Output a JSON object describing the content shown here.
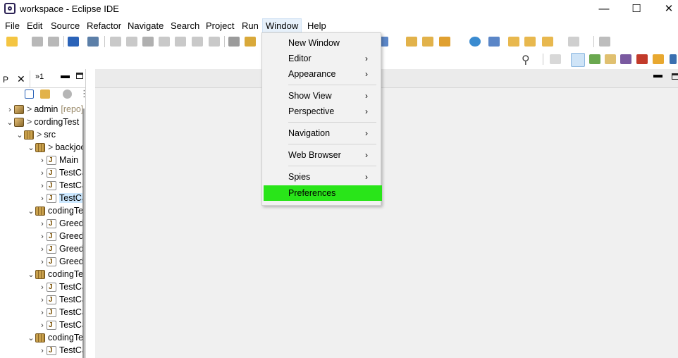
{
  "window": {
    "title": "workspace - Eclipse IDE",
    "minimize_glyph": "—",
    "maximize_glyph": "☐",
    "close_glyph": "✕"
  },
  "menubar": [
    "File",
    "Edit",
    "Source",
    "Refactor",
    "Navigate",
    "Search",
    "Project",
    "Run",
    "Window",
    "Help"
  ],
  "active_menu": "Window",
  "window_menu": {
    "items": [
      {
        "label": "New Window",
        "submenu": false
      },
      {
        "label": "Editor",
        "submenu": true
      },
      {
        "label": "Appearance",
        "submenu": true
      },
      {
        "label": "Show View",
        "submenu": true
      },
      {
        "label": "Perspective",
        "submenu": true
      },
      {
        "label": "Navigation",
        "submenu": true
      },
      {
        "label": "Web Browser",
        "submenu": true
      },
      {
        "label": "Spies",
        "submenu": true
      },
      {
        "label": "Preferences",
        "submenu": false,
        "highlighted": true
      }
    ],
    "arrow_glyph": "›",
    "highlight_color": "#29e519"
  },
  "left_panel": {
    "tab_label": "P",
    "close_glyph": "✕",
    "more_tabs": "»1",
    "minimize_glyph": "▬",
    "tree": [
      {
        "label": "admin",
        "decor": "[repo]",
        "prefix": ">",
        "icon": "project",
        "expanded": false
      },
      {
        "label": "cordingTest",
        "prefix": ">",
        "icon": "project",
        "expanded": true
      },
      {
        "label": "src",
        "prefix": ">",
        "icon": "pkg",
        "expanded": true
      },
      {
        "label": "backjoon",
        "prefix": ">",
        "icon": "pkg",
        "expanded": true
      },
      {
        "label": "Main",
        "icon": "java",
        "expanded": false
      },
      {
        "label": "TestCase",
        "icon": "java",
        "expanded": false
      },
      {
        "label": "TestCase",
        "icon": "java",
        "expanded": false
      },
      {
        "label": "TestCase",
        "icon": "java",
        "expanded": false,
        "selected": true
      },
      {
        "label": "codingTest",
        "icon": "pkg",
        "expanded": true
      },
      {
        "label": "Greedy",
        "icon": "java",
        "expanded": false
      },
      {
        "label": "Greedy",
        "icon": "java",
        "expanded": false
      },
      {
        "label": "Greedy",
        "icon": "java",
        "expanded": false
      },
      {
        "label": "Greedy",
        "icon": "java",
        "expanded": false
      },
      {
        "label": "codingTest",
        "icon": "pkg",
        "expanded": true
      },
      {
        "label": "TestCase",
        "icon": "java",
        "expanded": false
      },
      {
        "label": "TestCase",
        "icon": "java",
        "expanded": false
      },
      {
        "label": "TestCase",
        "icon": "java",
        "expanded": false
      },
      {
        "label": "TestCase",
        "icon": "java",
        "expanded": false
      },
      {
        "label": "codingTest",
        "icon": "pkg",
        "expanded": true
      },
      {
        "label": "TestCase",
        "icon": "java",
        "expanded": false
      }
    ]
  },
  "editor": {
    "minimize_glyph": "▬"
  },
  "colors": {
    "accent_highlight": "#29e519",
    "selection": "#cce8ff",
    "menu_bg": "#f2f2f2",
    "editor_bg": "#f0f0f0"
  }
}
